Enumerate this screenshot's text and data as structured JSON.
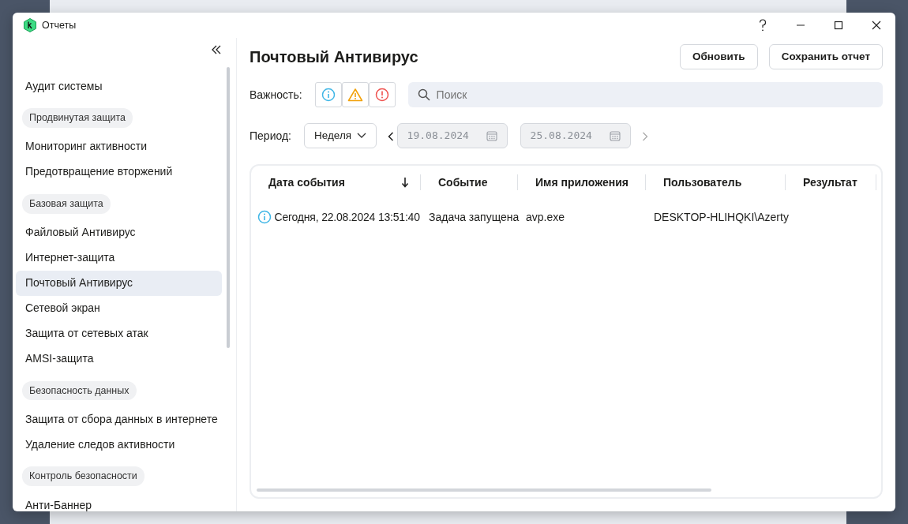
{
  "window": {
    "title": "Отчеты"
  },
  "sidebar": {
    "items": [
      {
        "kind": "item",
        "label": "Аудит системы",
        "selected": false
      },
      {
        "kind": "group",
        "label": "Продвинутая защита"
      },
      {
        "kind": "item",
        "label": "Мониторинг активности",
        "selected": false
      },
      {
        "kind": "item",
        "label": "Предотвращение вторжений",
        "selected": false
      },
      {
        "kind": "group",
        "label": "Базовая защита"
      },
      {
        "kind": "item",
        "label": "Файловый Антивирус",
        "selected": false
      },
      {
        "kind": "item",
        "label": "Интернет-защита",
        "selected": false
      },
      {
        "kind": "item",
        "label": "Почтовый Антивирус",
        "selected": true
      },
      {
        "kind": "item",
        "label": "Сетевой экран",
        "selected": false
      },
      {
        "kind": "item",
        "label": "Защита от сетевых атак",
        "selected": false
      },
      {
        "kind": "item",
        "label": "AMSI-защита",
        "selected": false
      },
      {
        "kind": "group",
        "label": "Безопасность данных"
      },
      {
        "kind": "item",
        "label": "Защита от сбора данных в интернете",
        "selected": false
      },
      {
        "kind": "item",
        "label": "Удаление следов активности",
        "selected": false
      },
      {
        "kind": "group",
        "label": "Контроль безопасности"
      },
      {
        "kind": "item",
        "label": "Анти-Баннер",
        "selected": false
      }
    ]
  },
  "main": {
    "title": "Почтовый Антивирус",
    "buttons": [
      "Обновить",
      "Сохранить отчет"
    ],
    "severity": {
      "label": "Важность:",
      "levels": [
        {
          "kind": "info"
        },
        {
          "kind": "warning"
        },
        {
          "kind": "error"
        }
      ]
    },
    "search": {
      "placeholder": "Поиск"
    },
    "period": {
      "label": "Период:",
      "value": "Неделя",
      "date_from": "19.08.2024",
      "date_to": "25.08.2024"
    },
    "table": {
      "columns": [
        {
          "label": "Дата события",
          "sorted": true
        },
        {
          "label": "Событие",
          "sorted": false
        },
        {
          "label": "Имя приложения",
          "sorted": false
        },
        {
          "label": "Пользователь",
          "sorted": false
        },
        {
          "label": "Результат",
          "sorted": false
        }
      ],
      "rows": [
        {
          "kind": "info",
          "cells": [
            "Сегодня, 22.08.2024 13:51:40",
            "Задача запущена",
            "avp.exe",
            "DESKTOP-HLIHQKI\\Azerty",
            ""
          ]
        }
      ]
    }
  }
}
